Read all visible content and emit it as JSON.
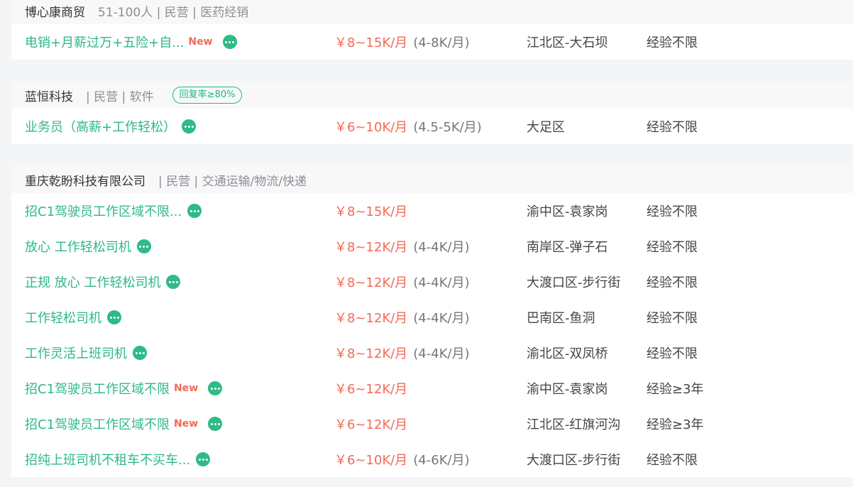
{
  "companies": [
    {
      "name": "博心康商贸",
      "meta": "51-100人 | 民营 | 医药经销",
      "badge": "",
      "jobs": [
        {
          "title": "电销+月薪过万+五险+自...",
          "is_new": true,
          "new_label": "New",
          "salary": "￥8~15K/月",
          "salary_extra": "(4-8K/月)",
          "area": "江北区-大石坝",
          "experience": "经验不限"
        }
      ]
    },
    {
      "name": "蓝恒科技",
      "meta": "| 民营 | 软件",
      "badge": "回复率≥80%",
      "jobs": [
        {
          "title": "业务员（高薪+工作轻松）",
          "is_new": false,
          "new_label": "",
          "salary": "￥6~10K/月",
          "salary_extra": "(4.5-5K/月)",
          "area": "大足区",
          "experience": "经验不限"
        }
      ]
    },
    {
      "name": "重庆乾盼科技有限公司",
      "meta": "| 民营 | 交通运输/物流/快递",
      "badge": "",
      "jobs": [
        {
          "title": "招C1驾驶员工作区域不限...",
          "is_new": false,
          "new_label": "",
          "salary": "￥8~15K/月",
          "salary_extra": "",
          "area": "渝中区-袁家岗",
          "experience": "经验不限"
        },
        {
          "title": "放心 工作轻松司机",
          "is_new": false,
          "new_label": "",
          "salary": "￥8~12K/月",
          "salary_extra": "(4-4K/月)",
          "area": "南岸区-弹子石",
          "experience": "经验不限"
        },
        {
          "title": "正规 放心 工作轻松司机",
          "is_new": false,
          "new_label": "",
          "salary": "￥8~12K/月",
          "salary_extra": "(4-4K/月)",
          "area": "大渡口区-步行街",
          "experience": "经验不限"
        },
        {
          "title": "工作轻松司机",
          "is_new": false,
          "new_label": "",
          "salary": "￥8~12K/月",
          "salary_extra": "(4-4K/月)",
          "area": "巴南区-鱼洞",
          "experience": "经验不限"
        },
        {
          "title": "工作灵活上班司机",
          "is_new": false,
          "new_label": "",
          "salary": "￥8~12K/月",
          "salary_extra": "(4-4K/月)",
          "area": "渝北区-双凤桥",
          "experience": "经验不限"
        },
        {
          "title": "招C1驾驶员工作区域不限",
          "is_new": true,
          "new_label": "New",
          "salary": "￥6~12K/月",
          "salary_extra": "",
          "area": "渝中区-袁家岗",
          "experience": "经验≥3年"
        },
        {
          "title": "招C1驾驶员工作区域不限",
          "is_new": true,
          "new_label": "New",
          "salary": "￥6~12K/月",
          "salary_extra": "",
          "area": "江北区-红旗河沟",
          "experience": "经验≥3年"
        },
        {
          "title": "招纯上班司机不租车不买车...",
          "is_new": false,
          "new_label": "",
          "salary": "￥6~10K/月",
          "salary_extra": "(4-6K/月)",
          "area": "大渡口区-步行街",
          "experience": "经验不限"
        }
      ]
    }
  ],
  "colors": {
    "accent_green": "#2eb888",
    "salary_red": "#f26a56",
    "new_tag": "#f26a56",
    "header_bg": "#f8f8f9",
    "page_bg": "#f4f5f7"
  },
  "icons": {
    "chat": "chat-bubble-icon"
  }
}
